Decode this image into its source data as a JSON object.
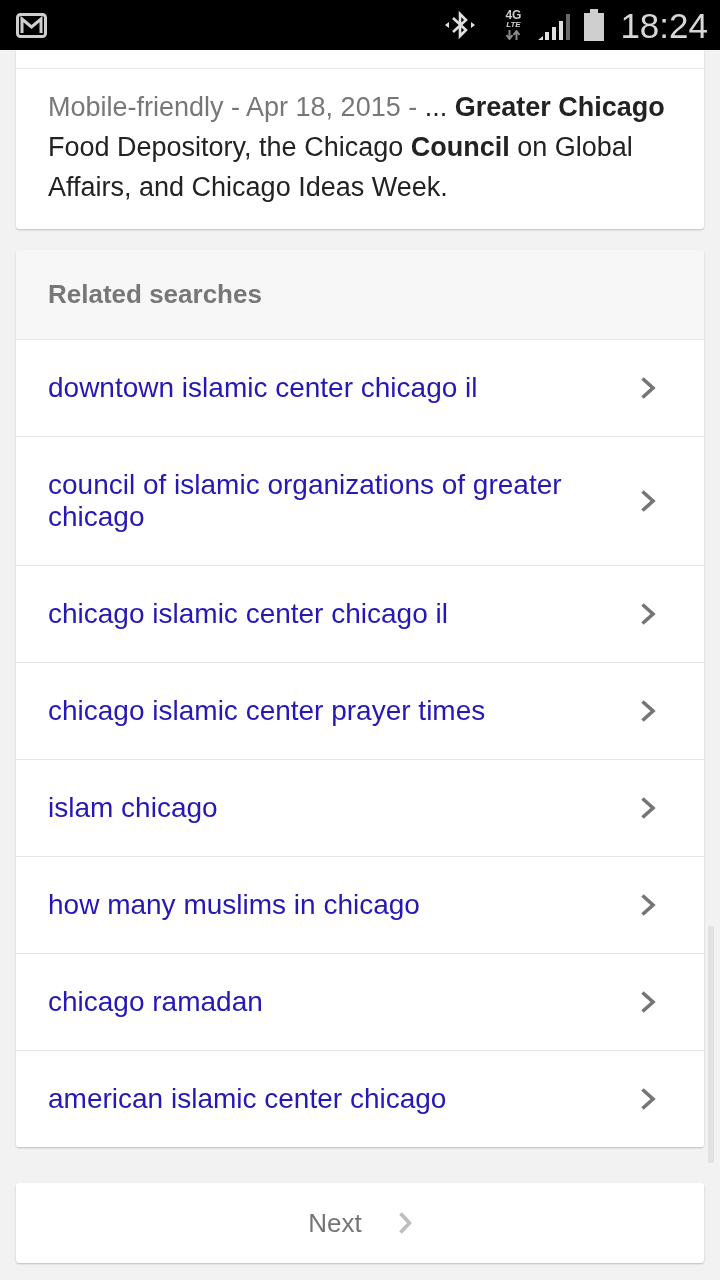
{
  "status_bar": {
    "network_type": "4G",
    "network_tech": "LTE",
    "time": "18:24"
  },
  "result": {
    "meta": "Mobile-friendly - Apr 18, 2015 -",
    "text": "... **Greater Chicago** Food Depository, the Chicago **Council** on Global Affairs, and Chicago Ideas Week."
  },
  "related_searches": {
    "title": "Related searches",
    "items": [
      {
        "label": "downtown islamic center chicago il"
      },
      {
        "label": "council of islamic organizations of greater chicago"
      },
      {
        "label": "chicago islamic center chicago il"
      },
      {
        "label": "chicago islamic center prayer times"
      },
      {
        "label": "islam chicago"
      },
      {
        "label": "how many muslims in chicago"
      },
      {
        "label": "chicago ramadan"
      },
      {
        "label": "american islamic center chicago"
      }
    ]
  },
  "pagination": {
    "next_label": "Next"
  }
}
